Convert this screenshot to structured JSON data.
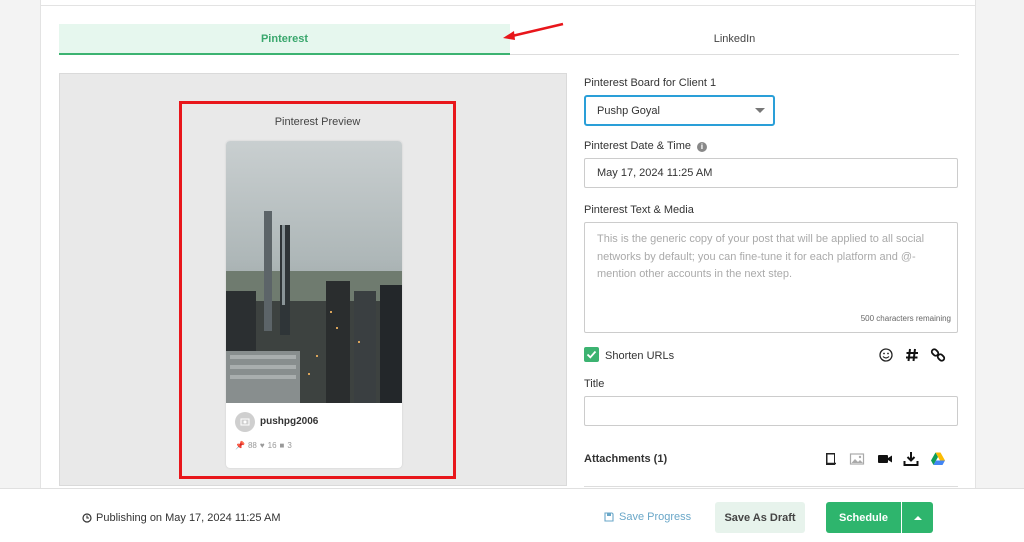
{
  "tabs": [
    {
      "label": "Pinterest",
      "active": true
    },
    {
      "label": "LinkedIn",
      "active": false
    }
  ],
  "preview": {
    "title": "Pinterest Preview",
    "username": "pushpg2006",
    "stats": {
      "pins": "88",
      "likes": "16",
      "comments": "3"
    }
  },
  "form": {
    "board_label": "Pinterest Board for Client 1",
    "board_value": "Pushp Goyal",
    "datetime_label": "Pinterest Date & Time",
    "datetime_value": "May 17, 2024 11:25 AM",
    "text_label": "Pinterest Text & Media",
    "text_placeholder": "This is the generic copy of your post that will be applied to all social networks by default; you can fine-tune it for each platform and @-mention other accounts in the next step.",
    "chars_remaining": "500 characters remaining",
    "shorten_urls_label": "Shorten URLs",
    "shorten_urls_checked": true,
    "title_label": "Title",
    "title_value": "",
    "attachments_label": "Attachments (1)"
  },
  "footer": {
    "publishing_text": "Publishing on May 17, 2024 11:25 AM",
    "save_progress": "Save Progress",
    "save_draft": "Save As Draft",
    "schedule": "Schedule"
  },
  "colors": {
    "accent_green": "#2eb56d",
    "active_tab_bg": "#e6f7ee",
    "select_border": "#2a9fd8",
    "annotation_red": "#e8161b"
  }
}
